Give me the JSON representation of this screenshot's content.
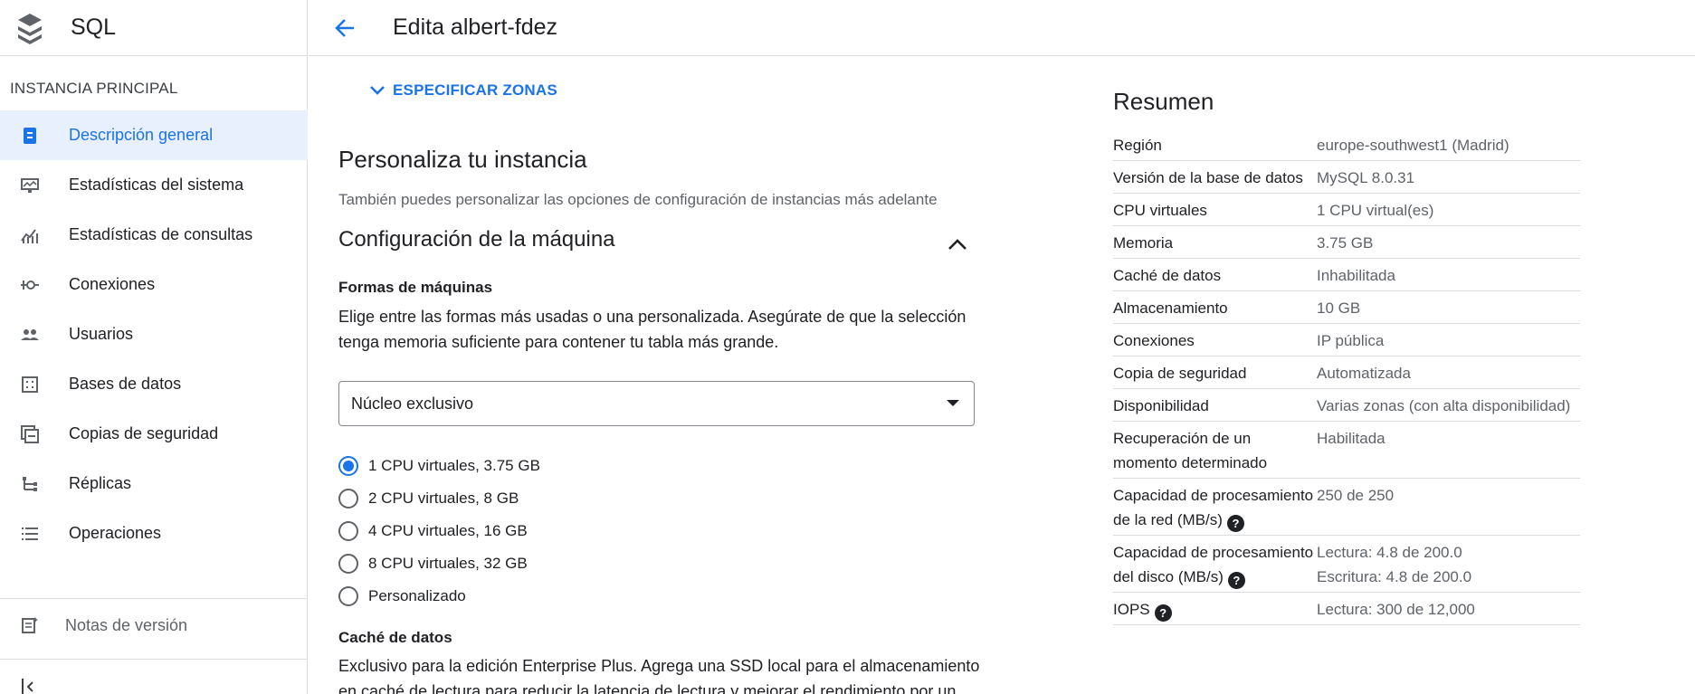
{
  "app": {
    "title": "SQL"
  },
  "sidebar": {
    "section": "INSTANCIA PRINCIPAL",
    "items": [
      {
        "label": "Descripción general",
        "icon": "dashboard-icon",
        "active": true
      },
      {
        "label": "Estadísticas del sistema",
        "icon": "monitor-icon"
      },
      {
        "label": "Estadísticas de consultas",
        "icon": "query-insights-icon"
      },
      {
        "label": "Conexiones",
        "icon": "connections-icon"
      },
      {
        "label": "Usuarios",
        "icon": "users-icon"
      },
      {
        "label": "Bases de datos",
        "icon": "databases-icon"
      },
      {
        "label": "Copias de seguridad",
        "icon": "backup-icon"
      },
      {
        "label": "Réplicas",
        "icon": "replicas-icon"
      },
      {
        "label": "Operaciones",
        "icon": "operations-icon"
      }
    ],
    "release_notes": "Notas de versión"
  },
  "header": {
    "title": "Edita albert-fdez"
  },
  "main": {
    "zones_link": "ESPECIFICAR ZONAS",
    "customize_title": "Personaliza tu instancia",
    "customize_desc": "También puedes personalizar las opciones de configuración de instancias más adelante",
    "machine_title": "Configuración de la máquina",
    "shapes_title": "Formas de máquinas",
    "shapes_desc": "Elige entre las formas más usadas o una personalizada. Asegúrate de que la selección tenga memoria suficiente para contener tu tabla más grande.",
    "select_value": "Núcleo exclusivo",
    "radio_options": [
      {
        "label": "1 CPU virtuales, 3.75 GB",
        "checked": true
      },
      {
        "label": "2 CPU virtuales, 8 GB",
        "checked": false
      },
      {
        "label": "4 CPU virtuales, 16 GB",
        "checked": false
      },
      {
        "label": "8 CPU virtuales, 32 GB",
        "checked": false
      },
      {
        "label": "Personalizado",
        "checked": false
      }
    ],
    "cache_title": "Caché de datos",
    "cache_desc": "Exclusivo para la edición Enterprise Plus. Agrega una SSD local para el almacenamiento en caché de lectura para reducir la latencia de lectura y mejorar el rendimiento por un"
  },
  "summary": {
    "title": "Resumen",
    "rows": [
      {
        "key": "Región",
        "value": "europe-southwest1 (Madrid)"
      },
      {
        "key": "Versión de la base de datos",
        "value": "MySQL 8.0.31"
      },
      {
        "key": "CPU virtuales",
        "value": "1 CPU virtual(es)"
      },
      {
        "key": "Memoria",
        "value": "3.75 GB"
      },
      {
        "key": "Caché de datos",
        "value": "Inhabilitada"
      },
      {
        "key": "Almacenamiento",
        "value": "10 GB"
      },
      {
        "key": "Conexiones",
        "value": "IP pública"
      },
      {
        "key": "Copia de seguridad",
        "value": "Automatizada"
      },
      {
        "key": "Disponibilidad",
        "value": "Varias zonas (con alta disponibilidad)"
      },
      {
        "key": "Recuperación de un momento determinado",
        "value": "Habilitada"
      },
      {
        "key": "Capacidad de procesamiento de la red (MB/s)",
        "value": "250 de 250",
        "help": true
      },
      {
        "key": "Capacidad de procesamiento del disco (MB/s)",
        "value": "Lectura: 4.8 de 200.0",
        "value2": "Escritura: 4.8 de 200.0",
        "help": true
      },
      {
        "key": "IOPS",
        "value": "Lectura: 300 de 12,000",
        "help": true
      }
    ]
  },
  "colors": {
    "accent": "#1a73e8",
    "active_bg": "#e8f0fe",
    "border": "#dadce0",
    "muted": "#5f6368"
  }
}
